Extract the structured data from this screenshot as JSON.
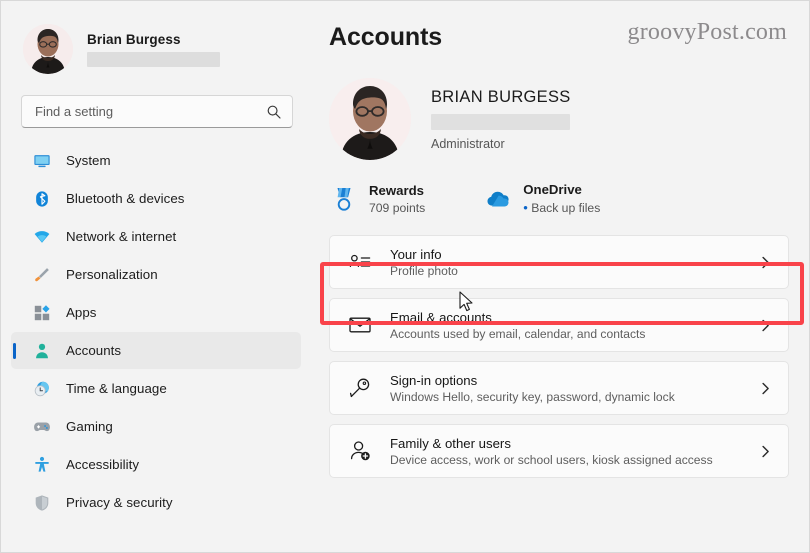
{
  "window": {
    "page_title": "Accounts",
    "watermark": "groovyPost.com"
  },
  "sidebar": {
    "profile": {
      "name": "Brian Burgess",
      "email_redacted": ""
    },
    "search": {
      "placeholder": "Find a setting",
      "value": "",
      "icon": "search-icon"
    },
    "items": [
      {
        "label": "System",
        "icon": "monitor-icon",
        "selected": false
      },
      {
        "label": "Bluetooth & devices",
        "icon": "bluetooth-icon",
        "selected": false
      },
      {
        "label": "Network & internet",
        "icon": "wifi-icon",
        "selected": false
      },
      {
        "label": "Personalization",
        "icon": "paintbrush-icon",
        "selected": false
      },
      {
        "label": "Apps",
        "icon": "apps-icon",
        "selected": false
      },
      {
        "label": "Accounts",
        "icon": "person-icon",
        "selected": true
      },
      {
        "label": "Time & language",
        "icon": "clock-globe-icon",
        "selected": false
      },
      {
        "label": "Gaming",
        "icon": "gamepad-icon",
        "selected": false
      },
      {
        "label": "Accessibility",
        "icon": "accessibility-icon",
        "selected": false
      },
      {
        "label": "Privacy & security",
        "icon": "shield-icon",
        "selected": false
      }
    ]
  },
  "main": {
    "account": {
      "name": "BRIAN BURGESS",
      "email_redacted": "",
      "role": "Administrator"
    },
    "services": [
      {
        "title": "Rewards",
        "subtitle": "709 points",
        "icon": "medal-icon",
        "bullet": false
      },
      {
        "title": "OneDrive",
        "subtitle": "Back up files",
        "icon": "cloud-icon",
        "bullet": true
      }
    ],
    "cards": [
      {
        "title": "Your info",
        "subtitle": "Profile photo",
        "icon": "contact-card-icon",
        "chevron": "chevron-right-icon",
        "highlighted": true
      },
      {
        "title": "Email & accounts",
        "subtitle": "Accounts used by email, calendar, and contacts",
        "icon": "envelope-icon",
        "chevron": "chevron-right-icon",
        "highlighted": false
      },
      {
        "title": "Sign-in options",
        "subtitle": "Windows Hello, security key, password, dynamic lock",
        "icon": "key-icon",
        "chevron": "chevron-right-icon",
        "highlighted": false
      },
      {
        "title": "Family & other users",
        "subtitle": "Device access, work or school users, kiosk assigned access",
        "icon": "person-add-icon",
        "chevron": "chevron-right-icon",
        "highlighted": false
      }
    ]
  },
  "annotation": {
    "highlight_color": "#f9434a",
    "cursor": "mouse-pointer-icon"
  },
  "colors": {
    "accent": "#0a64c8",
    "accounts_icon": "#21b19b",
    "sidebar_bg": "#f3f3f3",
    "card_bg": "#fbfbfb"
  }
}
